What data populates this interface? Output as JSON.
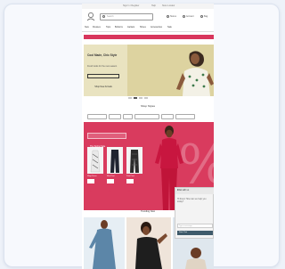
{
  "window": {
    "title": ""
  },
  "utility_bar": {
    "links": [
      "Sign In / Register",
      "Help",
      "Store Locator"
    ]
  },
  "header": {
    "logo_icon": "brand-logo",
    "search": {
      "placeholder": "Search",
      "icon": "search-icon"
    },
    "links": [
      "Stores",
      "Account",
      "Bag"
    ]
  },
  "nav": {
    "items": [
      "New",
      "Dresses",
      "Tops",
      "Bottoms",
      "Jackets",
      "Shoes",
      "Accessories",
      "Sale"
    ]
  },
  "promo": {
    "text": "Free shipping on orders over $75 | Shop now"
  },
  "hero": {
    "headline": "Cool Made, Chic Style",
    "subtext": "Fresh looks for the new season",
    "cta": "Shop New Arrivals",
    "bg_color": "#e9e3c0"
  },
  "carousel": {
    "slides": 4,
    "active": 1
  },
  "section1": {
    "title": "Shop Styles",
    "pills": [
      "New Arrivals",
      "Dresses",
      "Tops",
      "Bottoms & Jeans",
      "Jackets",
      "Best Sellers"
    ]
  },
  "pink_block": {
    "label": "The Spring Sale",
    "big_text": "%",
    "bg_color": "#d93b5e",
    "products": [
      {
        "name": "Wrap Dress",
        "price": "$49"
      },
      {
        "name": "Slim Pant",
        "price": "$39"
      },
      {
        "name": "Print Pant",
        "price": "$39"
      }
    ]
  },
  "chat": {
    "title": "Chat with us",
    "close": "×",
    "body": "Hi there! How can we help you today?",
    "input_placeholder": "Type a message",
    "send_label": "Start Chat"
  },
  "section2": {
    "title": "Trending Now"
  },
  "colors": {
    "accent": "#d93b5e",
    "chat_button": "#3e5a6a"
  }
}
